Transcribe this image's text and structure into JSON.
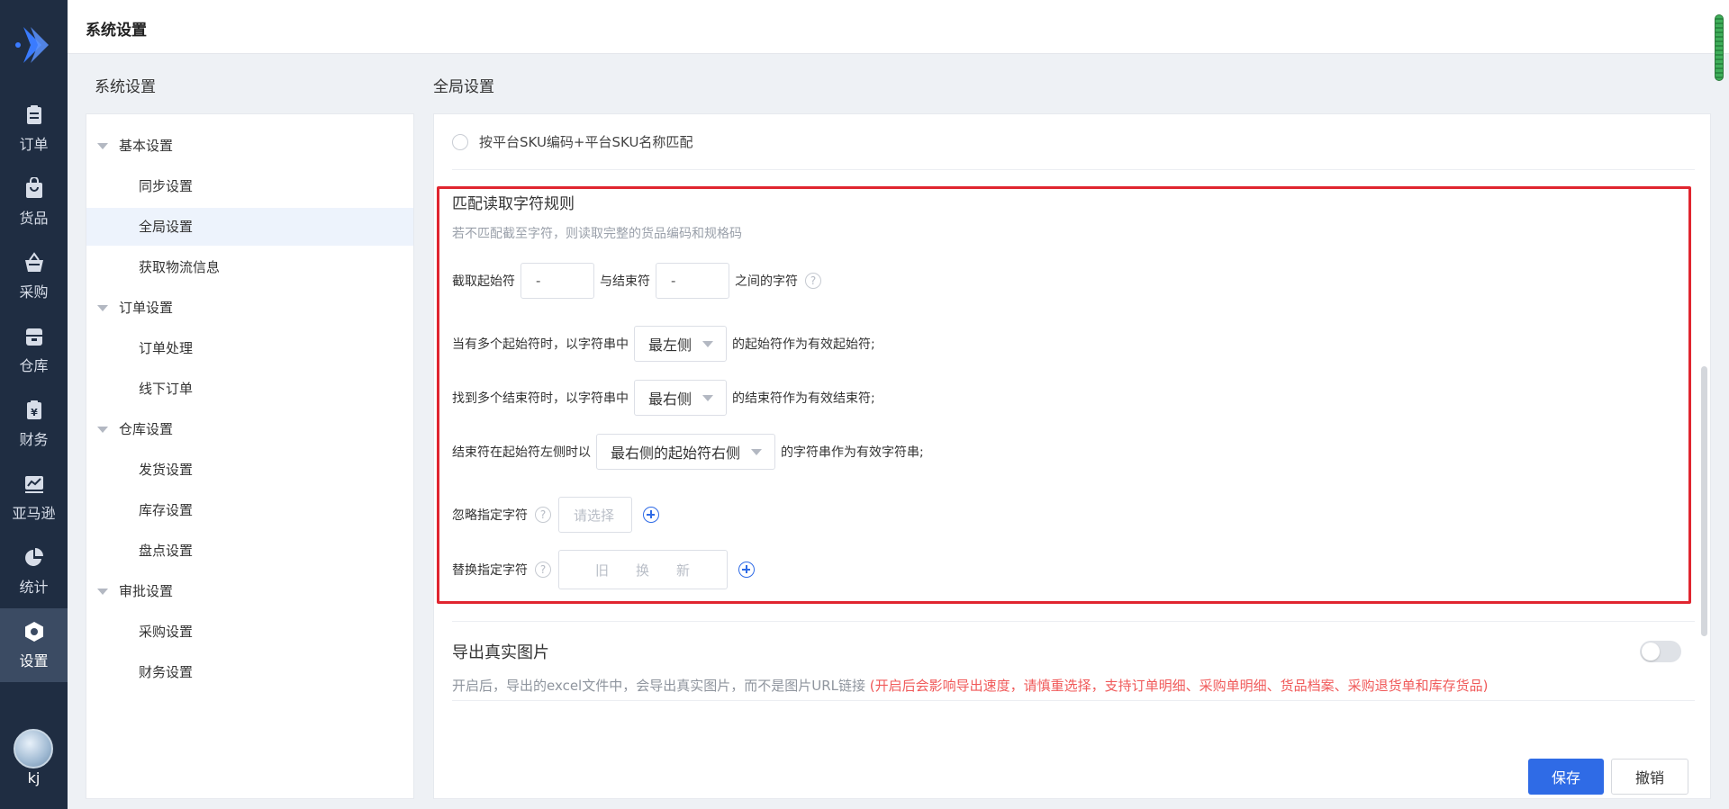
{
  "header": {
    "title": "系统设置"
  },
  "nav": {
    "items": [
      {
        "label": "订单",
        "icon": "order-icon"
      },
      {
        "label": "货品",
        "icon": "goods-icon"
      },
      {
        "label": "采购",
        "icon": "purchase-icon"
      },
      {
        "label": "仓库",
        "icon": "warehouse-icon"
      },
      {
        "label": "财务",
        "icon": "finance-icon"
      },
      {
        "label": "亚马逊",
        "icon": "amazon-chart-icon"
      },
      {
        "label": "统计",
        "icon": "pie-chart-icon"
      },
      {
        "label": "设置",
        "icon": "settings-icon",
        "active": true
      }
    ],
    "user": "kj"
  },
  "left": {
    "title": "系统设置",
    "tree": [
      {
        "label": "基本设置",
        "type": "group"
      },
      {
        "label": "同步设置",
        "type": "child"
      },
      {
        "label": "全局设置",
        "type": "child",
        "active": true
      },
      {
        "label": "获取物流信息",
        "type": "child"
      },
      {
        "label": "订单设置",
        "type": "group"
      },
      {
        "label": "订单处理",
        "type": "child"
      },
      {
        "label": "线下订单",
        "type": "child"
      },
      {
        "label": "仓库设置",
        "type": "group"
      },
      {
        "label": "发货设置",
        "type": "child"
      },
      {
        "label": "库存设置",
        "type": "child"
      },
      {
        "label": "盘点设置",
        "type": "child"
      },
      {
        "label": "审批设置",
        "type": "group"
      },
      {
        "label": "采购设置",
        "type": "child"
      },
      {
        "label": "财务设置",
        "type": "child"
      }
    ]
  },
  "main": {
    "title": "全局设置",
    "radio_option": "按平台SKU编码+平台SKU名称匹配",
    "rule": {
      "title": "匹配读取字符规则",
      "hint": "若不匹配截至字符，则读取完整的货品编码和规格码",
      "row1": {
        "prefix": "截取起始符",
        "start_value": "-",
        "mid": "与结束符",
        "end_value": "-",
        "suffix": "之间的字符"
      },
      "row2": {
        "prefix": "当有多个起始符时，以字符串中",
        "select": "最左侧",
        "suffix": "的起始符作为有效起始符;"
      },
      "row3": {
        "prefix": "找到多个结束符时，以字符串中",
        "select": "最右侧",
        "suffix": "的结束符作为有效结束符;"
      },
      "row4": {
        "prefix": "结束符在起始符左侧时以",
        "select": "最右侧的起始符右侧",
        "suffix": "的字符串作为有效字符串;"
      },
      "row5": {
        "label": "忽略指定字符",
        "placeholder": "请选择"
      },
      "row6": {
        "label": "替换指定字符",
        "old": "旧",
        "arrow": "换",
        "new": "新"
      },
      "help_glyph": "?"
    },
    "export": {
      "title": "导出真实图片",
      "desc": "开启后，导出的excel文件中，会导出真实图片，而不是图片URL链接",
      "warn": "(开启后会影响导出速度，请慎重选择，支持订单明细、采购单明细、货品档案、采购退货单和库存货品)",
      "enabled": false
    },
    "buttons": {
      "save": "保存",
      "cancel": "撤销"
    }
  },
  "colors": {
    "nav_bg": "#1f2d42",
    "accent": "#2f6be6",
    "highlight_box": "#e0252f",
    "warn_text": "#f05a5a"
  }
}
